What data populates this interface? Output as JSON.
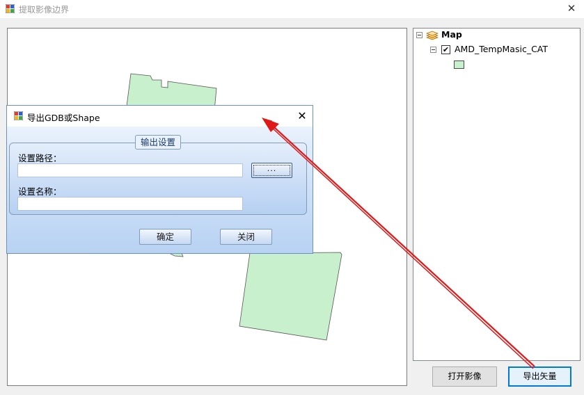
{
  "window": {
    "title": "提取影像边界",
    "close_glyph": "✕",
    "icon": "app-icon"
  },
  "toc": {
    "map_label": "Map",
    "map_icon": "layers-icon",
    "layer_label": "AMD_TempMasic_CAT",
    "layer_checked": "✔",
    "swatch_color": "#c8f0cc"
  },
  "buttons": {
    "open_image": "打开影像",
    "export_vector": "导出矢量"
  },
  "map": {
    "polygon_fill": "#c8f0cc",
    "polygon_stroke": "#555555"
  },
  "dialog": {
    "title": "导出GDB或Shape",
    "close_glyph": "✕",
    "group_title": "输出设置",
    "path_label": "设置路径：",
    "path_value": "",
    "browse_label": "...",
    "name_label": "设置名称：",
    "name_value": "",
    "confirm_label": "确定",
    "close_label": "关闭"
  },
  "annotation": {
    "arrow_color": "#e01818"
  }
}
